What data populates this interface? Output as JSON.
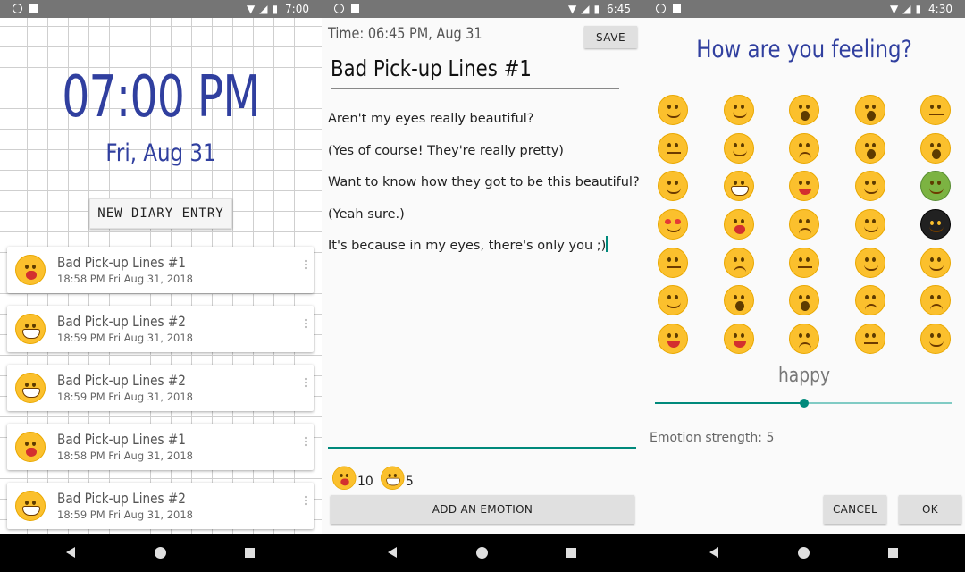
{
  "status_bars": [
    {
      "time": "7:00"
    },
    {
      "time": "6:45"
    },
    {
      "time": "4:30"
    }
  ],
  "home": {
    "time": "07:00 PM",
    "date": "Fri, Aug 31",
    "new_entry_label": "NEW DIARY ENTRY",
    "entries": [
      {
        "title": "Bad Pick-up Lines #1",
        "timestamp": "18:58 PM Fri Aug 31, 2018",
        "emoji": "kiss"
      },
      {
        "title": "Bad Pick-up Lines #2",
        "timestamp": "18:59 PM Fri Aug 31, 2018",
        "emoji": "grin"
      },
      {
        "title": "Bad Pick-up Lines #2",
        "timestamp": "18:59 PM Fri Aug 31, 2018",
        "emoji": "grin"
      },
      {
        "title": "Bad Pick-up Lines #1",
        "timestamp": "18:58 PM Fri Aug 31, 2018",
        "emoji": "kiss"
      },
      {
        "title": "Bad Pick-up Lines #2",
        "timestamp": "18:59 PM Fri Aug 31, 2018",
        "emoji": "grin"
      }
    ]
  },
  "editor": {
    "time_label": "Time:  06:45 PM, Aug 31",
    "save_label": "SAVE",
    "title": "Bad Pick-up Lines #1",
    "lines": [
      "Aren't my eyes really beautiful?",
      "(Yes of course! They're really pretty)",
      "Want to know how they got to be this beautiful?",
      "(Yeah sure.)",
      "It's because in my eyes, there's only you ;)"
    ],
    "emotions": [
      {
        "emoji": "kiss",
        "count": "10"
      },
      {
        "emoji": "grin",
        "count": "5"
      }
    ],
    "add_emotion_label": "ADD AN EMOTION"
  },
  "picker": {
    "title": "How are you feeling?",
    "emojis": [
      "unamused",
      "grimace",
      "openm",
      "openm",
      "flat",
      "flat",
      "confused",
      "sad",
      "openm",
      "openm",
      "happy",
      "grin",
      "tongue",
      "happy",
      "sick",
      "hearts",
      "kiss",
      "sad",
      "happy",
      "ninja",
      "flat",
      "sad",
      "flat",
      "happy",
      "happy",
      "happy",
      "openm",
      "openm",
      "sad",
      "sad",
      "tongue",
      "tongue",
      "sad",
      "flat",
      "happy"
    ],
    "selected_label": "happy",
    "slider_fraction": 0.5,
    "strength_text": "Emotion strength: 5",
    "cancel_label": "CANCEL",
    "ok_label": "OK"
  },
  "colors": {
    "accent": "#303f9f",
    "teal": "#00897b",
    "emoji_yellow": "#fbc02d"
  }
}
